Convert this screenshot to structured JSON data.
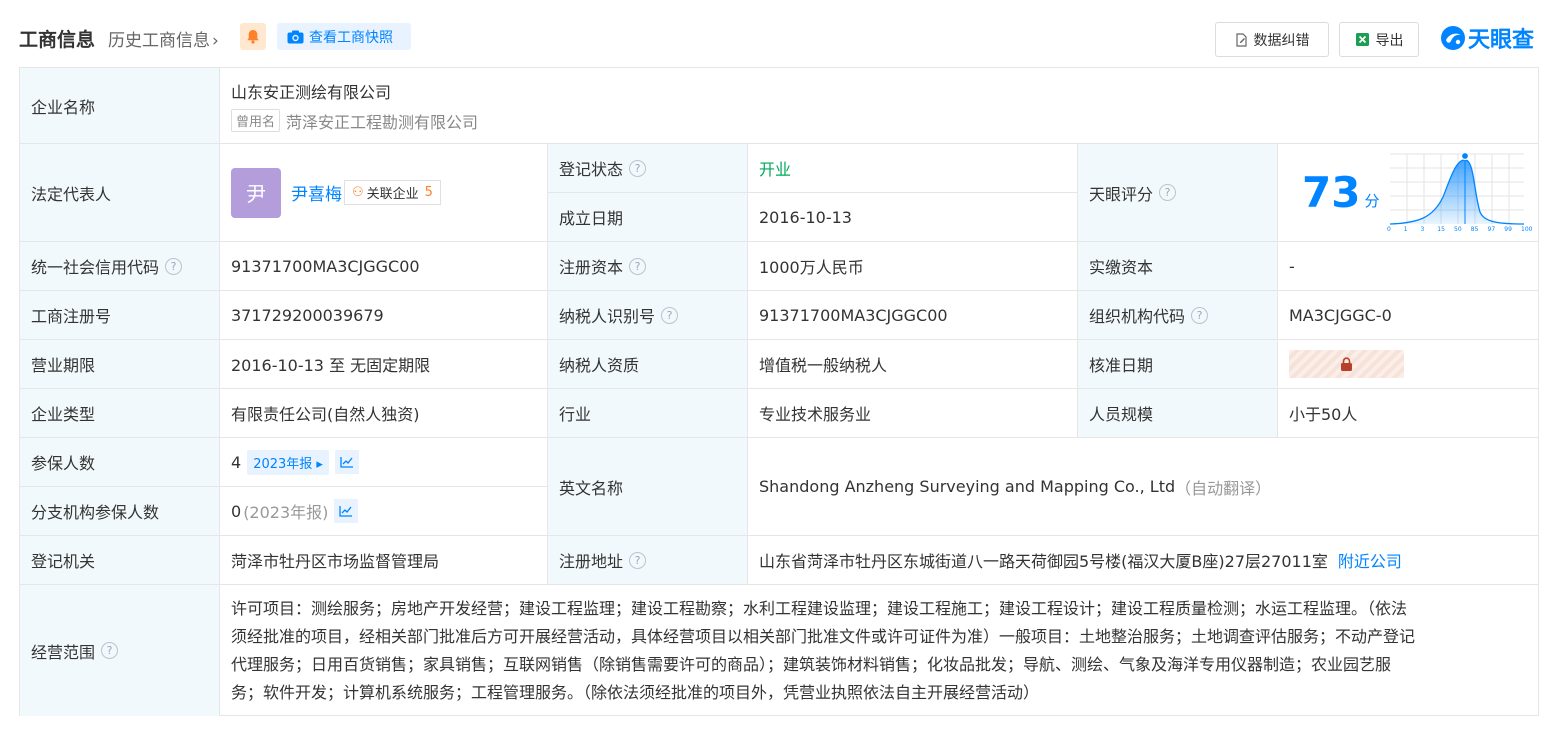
{
  "header": {
    "title": "工商信息",
    "history": "历史工商信息",
    "snapshot": "查看工商快照",
    "correct": "数据纠错",
    "export": "导出",
    "brand": "天眼查"
  },
  "company": {
    "name_label": "企业名称",
    "name": "山东安正测绘有限公司",
    "former_tag": "曾用名",
    "former_name": "菏泽安正工程勘测有限公司"
  },
  "legal": {
    "label": "法定代表人",
    "avatar_char": "尹",
    "name": "尹喜梅",
    "related_label": "关联企业",
    "related_count": "5"
  },
  "status": {
    "label": "登记状态",
    "value": "开业"
  },
  "founded": {
    "label": "成立日期",
    "value": "2016-10-13"
  },
  "score": {
    "label": "天眼评分",
    "value": "73",
    "unit": "分",
    "ticks": [
      "0",
      "1",
      "3",
      "15",
      "50",
      "85",
      "97",
      "99",
      "100"
    ]
  },
  "rows": {
    "credit_code": {
      "label": "统一社会信用代码",
      "value": "91371700MA3CJGGC00"
    },
    "reg_capital": {
      "label": "注册资本",
      "value": "1000万人民币"
    },
    "paid_capital": {
      "label": "实缴资本",
      "value": "-"
    },
    "reg_no": {
      "label": "工商注册号",
      "value": "371729200039679"
    },
    "tax_id": {
      "label": "纳税人识别号",
      "value": "91371700MA3CJGGC00"
    },
    "org_code": {
      "label": "组织机构代码",
      "value": "MA3CJGGC-0"
    },
    "term": {
      "label": "营业期限",
      "value": "2016-10-13 至 无固定期限"
    },
    "tax_type": {
      "label": "纳税人资质",
      "value": "增值税一般纳税人"
    },
    "approve_date": {
      "label": "核准日期"
    },
    "ent_type": {
      "label": "企业类型",
      "value": "有限责任公司(自然人独资)"
    },
    "industry": {
      "label": "行业",
      "value": "专业技术服务业"
    },
    "staff": {
      "label": "人员规模",
      "value": "小于50人"
    },
    "insured": {
      "label": "参保人数",
      "value": "4",
      "year": "2023年报"
    },
    "branch_insured": {
      "label": "分支机构参保人数",
      "value": "0",
      "year": "(2023年报)"
    },
    "english": {
      "label": "英文名称",
      "value": "Shandong Anzheng Surveying and Mapping Co., Ltd",
      "note": "（自动翻译）"
    },
    "authority": {
      "label": "登记机关",
      "value": "菏泽市牡丹区市场监督管理局"
    },
    "address": {
      "label": "注册地址",
      "value": "山东省菏泽市牡丹区东城街道八一路天荷御园5号楼(福汉大厦B座)27层27011室",
      "nearby": "附近公司"
    },
    "scope": {
      "label": "经营范围",
      "lines": [
        "许可项目：测绘服务；房地产开发经营；建设工程监理；建设工程勘察；水利工程建设监理；建设工程施工；建设工程设计；建设工程质量检测；水运工程监理。（依法",
        "须经批准的项目，经相关部门批准后方可开展经营活动，具体经营项目以相关部门批准文件或许可证件为准）一般项目：土地整治服务；土地调查评估服务；不动产登记",
        "代理服务；日用百货销售；家具销售；互联网销售（除销售需要许可的商品）；建筑装饰材料销售；化妆品批发；导航、测绘、气象及海洋专用仪器制造；农业园艺服",
        "务；软件开发；计算机系统服务；工程管理服务。（除依法须经批准的项目外，凭营业执照依法自主开展经营活动）"
      ]
    }
  }
}
